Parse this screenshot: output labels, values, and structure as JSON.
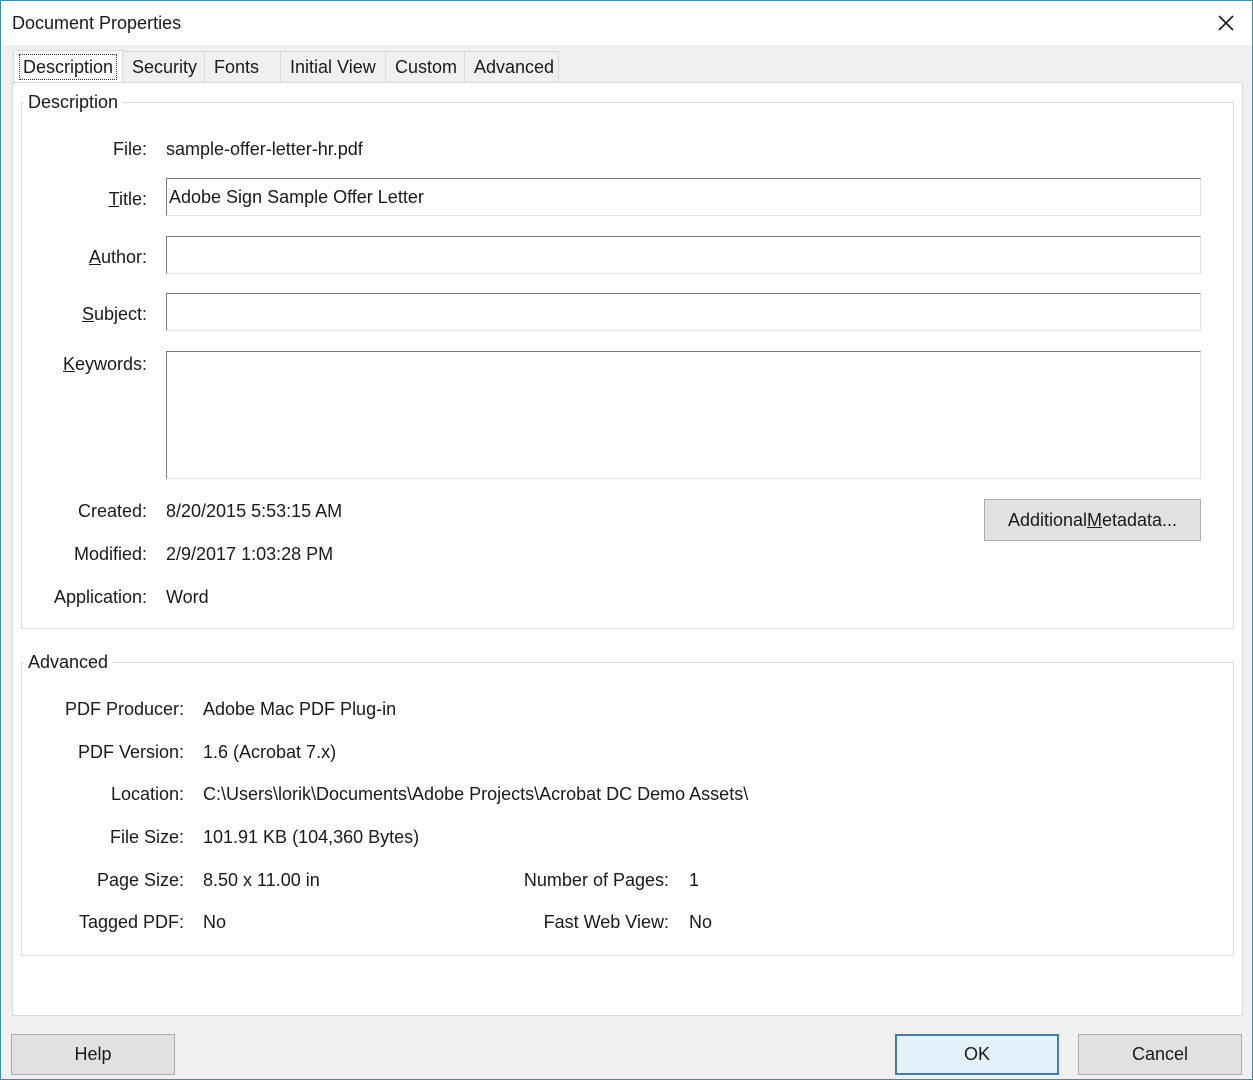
{
  "window": {
    "title": "Document Properties",
    "close_label": "Close"
  },
  "tabs": [
    {
      "label": "Description"
    },
    {
      "label": "Security"
    },
    {
      "label": "Fonts"
    },
    {
      "label": "Initial View"
    },
    {
      "label": "Custom"
    },
    {
      "label": "Advanced"
    }
  ],
  "description": {
    "group_title": "Description",
    "file_label": "File:",
    "file_value": "sample-offer-letter-hr.pdf",
    "title_label_pre": "",
    "title_label_ul": "T",
    "title_label_post": "itle:",
    "title_value": "Adobe Sign Sample Offer Letter",
    "author_label_ul": "A",
    "author_label_post": "uthor:",
    "author_value": "",
    "subject_label_ul": "S",
    "subject_label_post": "ubject:",
    "subject_value": "",
    "keywords_label_ul": "K",
    "keywords_label_post": "eywords:",
    "keywords_value": "",
    "created_label": "Created:",
    "created_value": "8/20/2015 5:53:15 AM",
    "modified_label": "Modified:",
    "modified_value": "2/9/2017 1:03:28 PM",
    "application_label": "Application:",
    "application_value": "Word",
    "metadata_button_pre": "Additional ",
    "metadata_button_ul": "M",
    "metadata_button_post": "etadata..."
  },
  "advanced": {
    "group_title": "Advanced",
    "producer_label": "PDF Producer:",
    "producer_value": "Adobe Mac PDF Plug-in",
    "version_label": "PDF Version:",
    "version_value": "1.6 (Acrobat 7.x)",
    "location_label": "Location:",
    "location_value": "C:\\Users\\lorik\\Documents\\Adobe Projects\\Acrobat DC Demo Assets\\",
    "filesize_label": "File Size:",
    "filesize_value": "101.91 KB (104,360 Bytes)",
    "pagesize_label": "Page Size:",
    "pagesize_value": "8.50 x 11.00 in",
    "numpages_label": "Number of Pages:",
    "numpages_value": "1",
    "tagged_label": "Tagged PDF:",
    "tagged_value": "No",
    "fastweb_label": "Fast Web View:",
    "fastweb_value": "No"
  },
  "footer": {
    "help_label": "Help",
    "ok_label": "OK",
    "cancel_label": "Cancel"
  }
}
